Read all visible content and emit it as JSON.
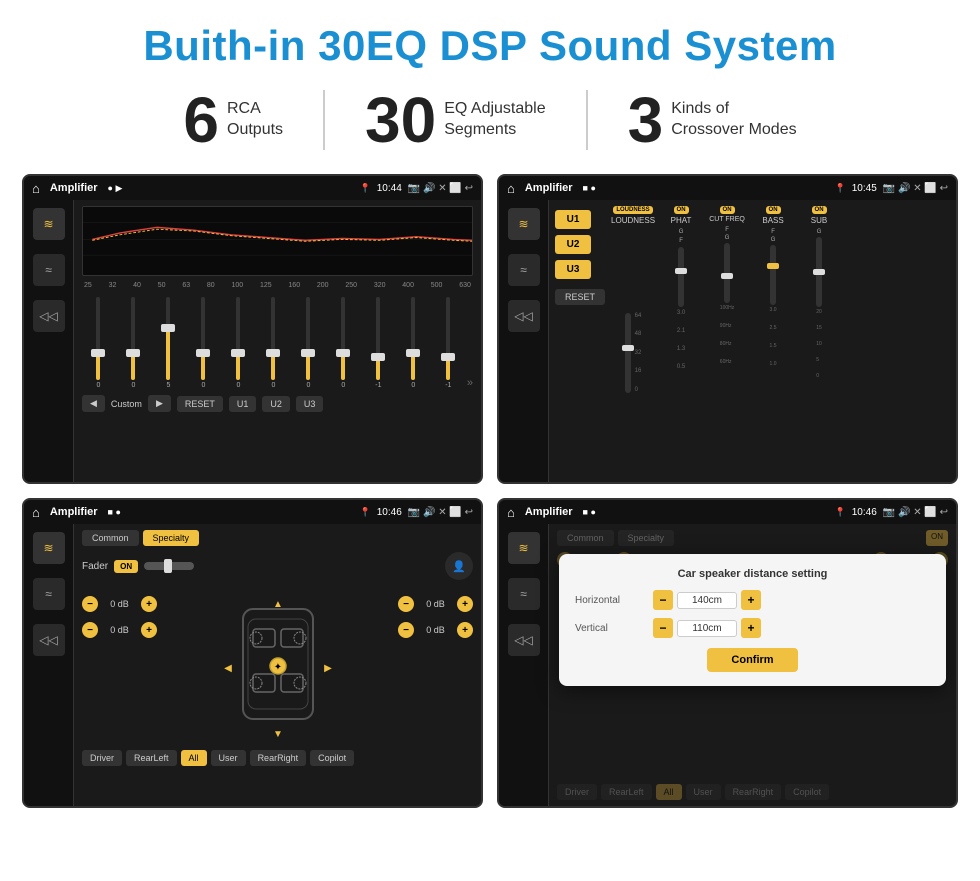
{
  "header": {
    "title": "Buith-in 30EQ DSP Sound System"
  },
  "stats": [
    {
      "number": "6",
      "label": "RCA\nOutputs"
    },
    {
      "number": "30",
      "label": "EQ Adjustable\nSegments"
    },
    {
      "number": "3",
      "label": "Kinds of\nCrossover Modes"
    }
  ],
  "screens": {
    "eq": {
      "title": "Amplifier",
      "time": "10:44",
      "freqs": [
        "25",
        "32",
        "40",
        "50",
        "63",
        "80",
        "100",
        "125",
        "160",
        "200",
        "250",
        "320",
        "400",
        "500",
        "630"
      ],
      "values": [
        "0",
        "0",
        "0",
        "5",
        "0",
        "0",
        "0",
        "0",
        "0",
        "0",
        "-1",
        "0",
        "-1"
      ],
      "buttons": [
        "Custom",
        "RESET",
        "U1",
        "U2",
        "U3"
      ]
    },
    "crossover": {
      "title": "Amplifier",
      "time": "10:45",
      "uButtons": [
        "U1",
        "U2",
        "U3"
      ],
      "channels": [
        {
          "name": "LOUDNESS",
          "on": true
        },
        {
          "name": "PHAT",
          "on": true
        },
        {
          "name": "CUT FREQ",
          "on": true
        },
        {
          "name": "BASS",
          "on": true
        },
        {
          "name": "SUB",
          "on": true
        }
      ],
      "reset": "RESET"
    },
    "fader": {
      "title": "Amplifier",
      "time": "10:46",
      "tabs": [
        "Common",
        "Specialty"
      ],
      "faderLabel": "Fader",
      "faderOn": "ON",
      "volumes": [
        "0 dB",
        "0 dB",
        "0 dB",
        "0 dB"
      ],
      "bottomBtns": [
        "Driver",
        "RearLeft",
        "All",
        "User",
        "RearRight",
        "Copilot"
      ]
    },
    "dialog": {
      "title": "Amplifier",
      "time": "10:46",
      "tabs": [
        "Common",
        "Specialty"
      ],
      "dialogTitle": "Car speaker distance setting",
      "horizontal": {
        "label": "Horizontal",
        "value": "140cm"
      },
      "vertical": {
        "label": "Vertical",
        "value": "110cm"
      },
      "confirm": "Confirm",
      "bottomBtns": [
        "Driver",
        "RearLeft",
        "All",
        "User",
        "RearRight",
        "Copilot"
      ]
    }
  },
  "icons": {
    "home": "⌂",
    "back": "↩",
    "settings": "≡",
    "eq": "≋",
    "speaker": "♪",
    "volume": "◁",
    "play": "▶",
    "prev": "◀",
    "next": "▶▶",
    "reset": "↺"
  }
}
